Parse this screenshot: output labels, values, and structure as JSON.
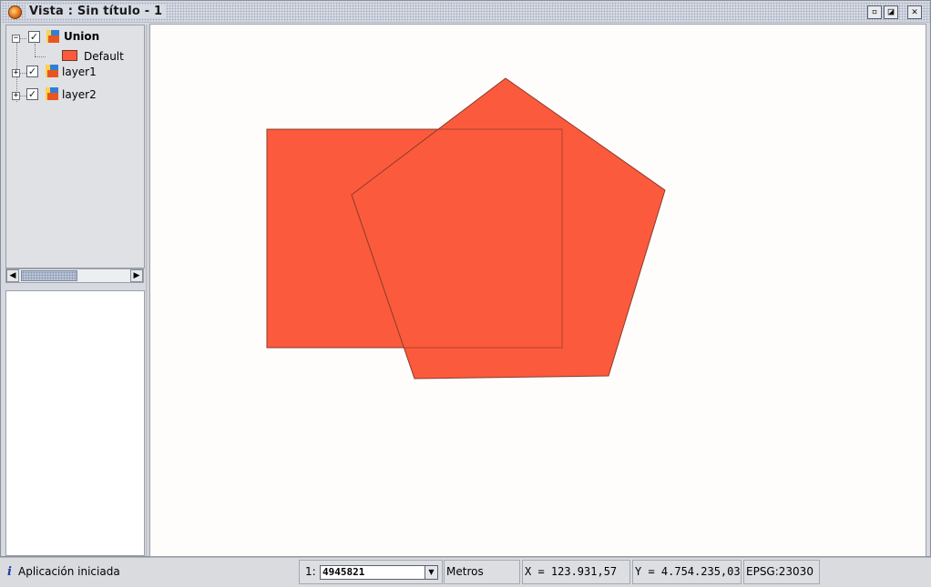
{
  "window": {
    "title": "Vista : Sin título - 1",
    "buttons": {
      "minimize": "▫",
      "maximize": "◪",
      "close": "✕"
    }
  },
  "toc": {
    "layers": [
      {
        "name": "Union",
        "checked": true,
        "expanded": true,
        "bold": true,
        "legend": "Default"
      },
      {
        "name": "layer1",
        "checked": true,
        "expanded": false
      },
      {
        "name": "layer2",
        "checked": true,
        "expanded": false
      }
    ],
    "expand_symbol": "+",
    "collapse_symbol": "−",
    "check_symbol": "✓"
  },
  "scrollbar": {
    "left_arrow": "◀",
    "right_arrow": "▶"
  },
  "map": {
    "fill_color": "#fc5a3c",
    "stroke_color": "#8a3b2c",
    "background": "#fefdfc"
  },
  "statusbar": {
    "info_icon": "i",
    "message": "Aplicación iniciada",
    "scale_prefix": "1:",
    "scale_value": "4945821",
    "scale_dropdown_arrow": "▼",
    "units": "Metros",
    "x_coord": "X = 123.931,57",
    "y_coord": "Y = 4.754.235,03",
    "crs": "EPSG:23030"
  }
}
